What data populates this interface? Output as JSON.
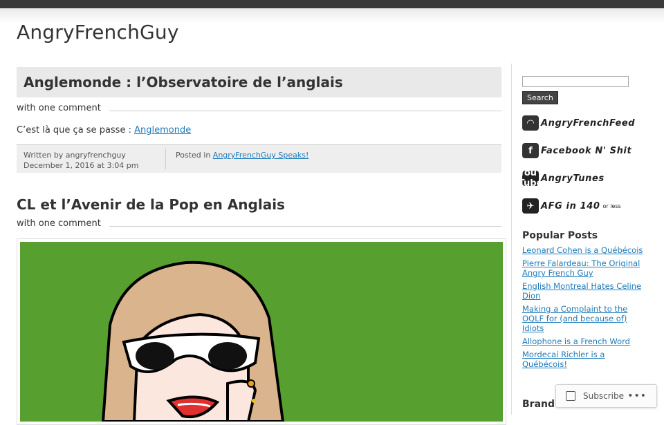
{
  "site": {
    "title": "AngryFrenchGuy"
  },
  "posts": [
    {
      "title": "Anglemonde : l’Observatoire de l’anglais",
      "comments": "with one comment",
      "body_prefix": "C’est là que ça se passe : ",
      "body_link": "Anglemonde",
      "written_by": "Written by angryfrenchguy",
      "date": "December 1, 2016 at 3:04 pm",
      "posted_in_label": "Posted in ",
      "category": "AngryFrenchGuy Speaks!"
    },
    {
      "title": "CL et l’Avenir de la Pop en Anglais",
      "comments": "with one comment"
    }
  ],
  "sidebar": {
    "search_button": "Search",
    "badges": [
      {
        "icon": "rss-icon",
        "label": "AngryFrenchFeed"
      },
      {
        "icon": "facebook-icon",
        "label": "Facebook N' Shit"
      },
      {
        "icon": "youtube-icon",
        "icon_text": "You Tube",
        "label": "AngryTunes"
      },
      {
        "icon": "twitter-icon",
        "label": "AFG in 140",
        "suffix": "or less"
      }
    ],
    "popular_title": "Popular Posts",
    "popular": [
      "Leonard Cohen is a Québécois",
      "Pierre Falardeau: The Original Angry French Guy",
      "English Montreal Hates Celine Dion",
      "Making a Complaint to the OQLF for (and because of) Idiots",
      "Allophone is a French Word",
      "Mordecai Richler is a Québécois!"
    ],
    "brand_new_title": "Brand New Posts"
  },
  "subscribe": {
    "label": "Subscribe",
    "more": "•••"
  },
  "colors": {
    "link": "#1e7ab9",
    "image_bg": "#57a02f",
    "topbar": "#3a3a3a"
  }
}
